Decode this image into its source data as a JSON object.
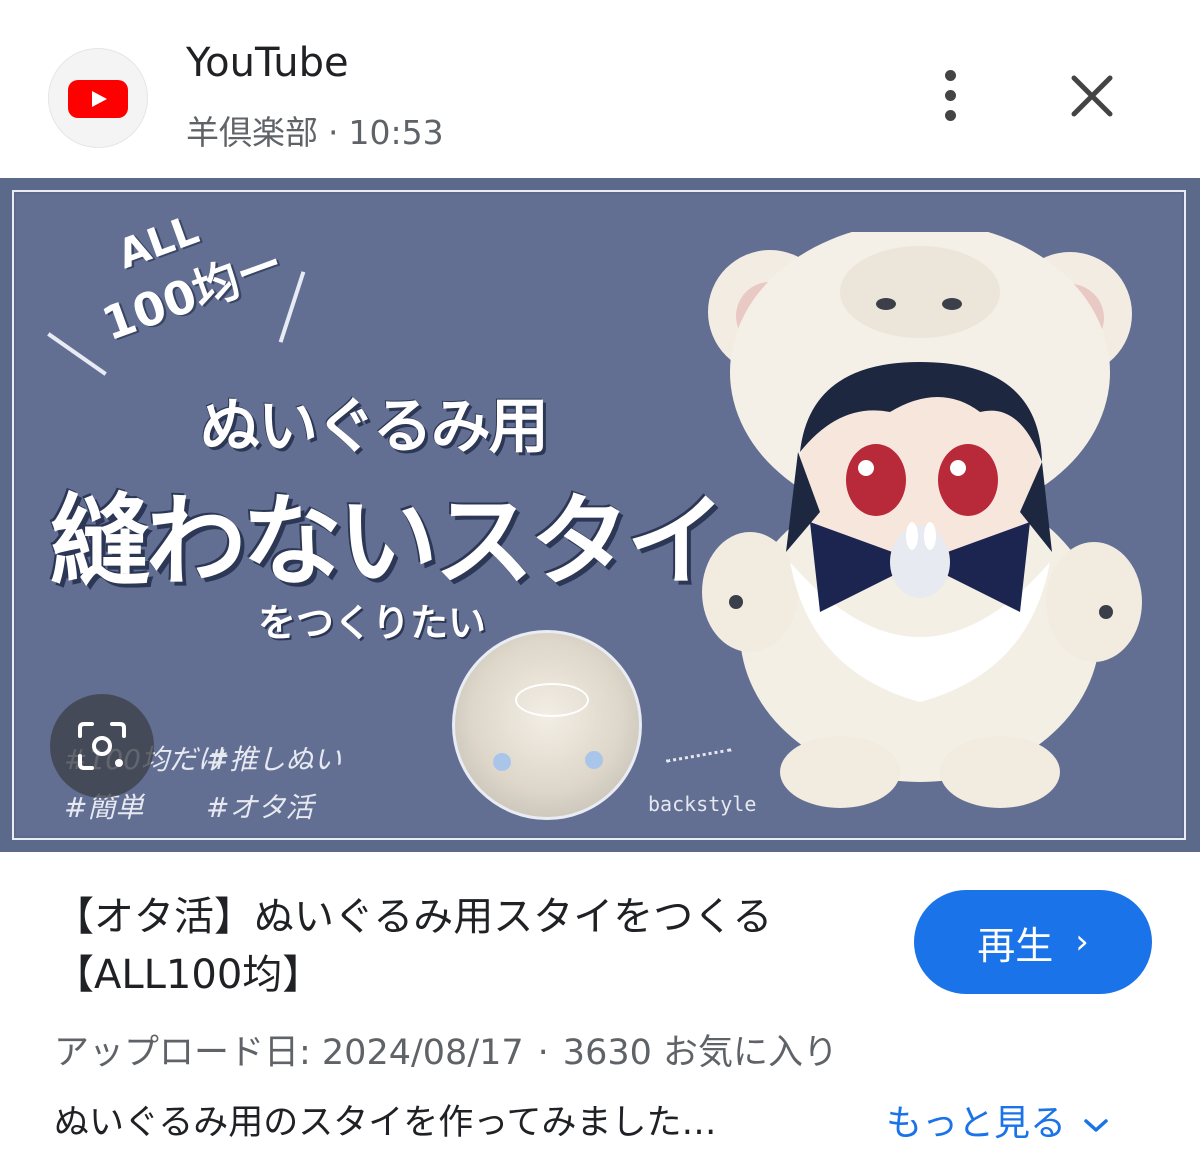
{
  "header": {
    "app_name": "YouTube",
    "channel": "羊倶楽部",
    "separator": "·",
    "time": "10:53",
    "icons": {
      "app": "youtube-logo-icon",
      "menu": "more-vert-icon",
      "close": "close-icon"
    },
    "brand_color": "#ff0000"
  },
  "thumbnail": {
    "badge_line1": "ALL",
    "badge_line2": "100均ー",
    "title_line1": "ぬいぐるみ用",
    "title_line2": "縫わないスタイ",
    "title_line3": "をつくりたい",
    "tags": [
      "#100均だけ",
      "#推しぬい",
      "#簡単",
      "#オタ活"
    ],
    "backstyle_label": "backstyle",
    "background_color": "#626f93",
    "lens_icon": "google-lens-icon"
  },
  "video": {
    "title": "【オタ活】ぬいぐるみ用スタイをつくる【ALL100均】",
    "play_label": "再生",
    "play_chevron": "›",
    "upload_label": "アップロード日: 2024/08/17",
    "meta_sep": "·",
    "favorites": "3630 お気に入り",
    "description": "ぬいぐるみ用のスタイを作ってみました…",
    "more_label": "もっと見る",
    "accent_color": "#1a73e8"
  }
}
